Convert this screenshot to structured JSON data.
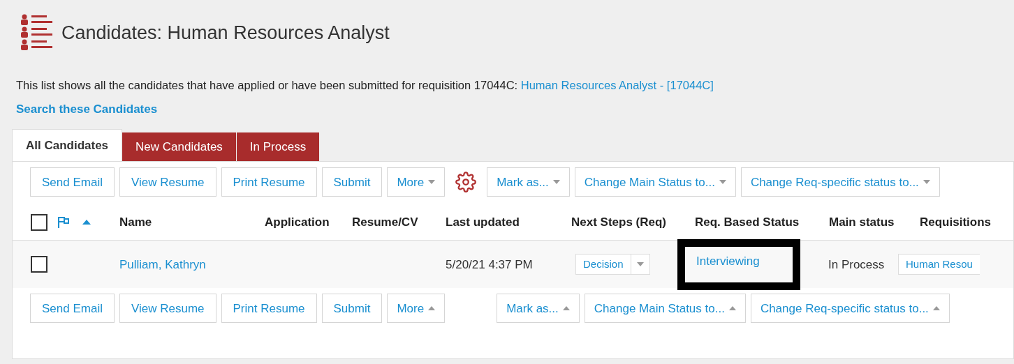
{
  "page": {
    "title": "Candidates: Human Resources Analyst",
    "intro": "This list shows all the candidates that have applied or have been submitted for requisition 17044C:",
    "intro_link": "Human Resources Analyst - [17044C]",
    "search_link": "Search these Candidates"
  },
  "tabs": [
    {
      "label": "All Candidates",
      "selected": true
    },
    {
      "label": "New Candidates",
      "selected": false
    },
    {
      "label": "In Process",
      "selected": false
    }
  ],
  "toolbar_top": [
    {
      "kind": "button",
      "label": "Send Email"
    },
    {
      "kind": "button",
      "label": "View Resume"
    },
    {
      "kind": "button",
      "label": "Print Resume"
    },
    {
      "kind": "button",
      "label": "Submit"
    },
    {
      "kind": "dropdown",
      "label": "More",
      "opens_upward": false
    },
    {
      "kind": "settings"
    },
    {
      "kind": "dropdown",
      "label": "Mark as...",
      "opens_upward": false
    },
    {
      "kind": "dropdown",
      "label": "Change Main Status to...",
      "opens_upward": false
    },
    {
      "kind": "dropdown",
      "label": "Change Req-specific status to...",
      "opens_upward": false
    }
  ],
  "table": {
    "select_all": {
      "checked": false
    },
    "flag_sorted_ascending": true,
    "columns": [
      "Name",
      "Application",
      "Resume/CV",
      "Last updated",
      "Next Steps (Req)",
      "Req. Based Status",
      "Main status",
      "Requisitions"
    ],
    "rows": [
      {
        "checked": false,
        "name": "Pulliam, Kathryn",
        "last_updated": "5/20/21 4:37 PM",
        "next_step": "Decision",
        "req_status": "Interviewing",
        "req_status_highlighted": true,
        "main_status": "In Process",
        "requisition": "Human Resou"
      }
    ]
  },
  "toolbar_bottom": [
    {
      "kind": "button",
      "label": "Send Email"
    },
    {
      "kind": "button",
      "label": "View Resume"
    },
    {
      "kind": "button",
      "label": "Print Resume"
    },
    {
      "kind": "button",
      "label": "Submit"
    },
    {
      "kind": "dropdown",
      "label": "More",
      "opens_upward": true
    },
    {
      "kind": "spacer"
    },
    {
      "kind": "dropdown",
      "label": "Mark as...",
      "opens_upward": true
    },
    {
      "kind": "dropdown",
      "label": "Change Main Status to...",
      "opens_upward": true
    },
    {
      "kind": "dropdown",
      "label": "Change Req-specific status to...",
      "opens_upward": true
    }
  ]
}
